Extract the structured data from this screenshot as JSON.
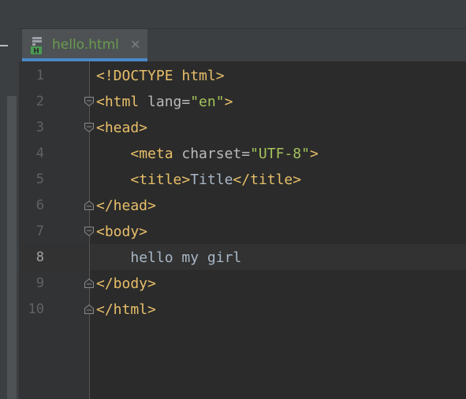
{
  "tab": {
    "filename": "hello.html",
    "close_glyph": "✕",
    "icon": "html-file-icon",
    "icon_letter": "H"
  },
  "line_numbers": [
    "1",
    "2",
    "3",
    "4",
    "5",
    "6",
    "7",
    "8",
    "9",
    "10"
  ],
  "code": {
    "line1": {
      "doctype": "<!DOCTYPE",
      "rest": " html>"
    },
    "line2": {
      "open": "<html",
      "attr": " lang",
      "eq": "=",
      "value": "\"en\"",
      "close": ">"
    },
    "line3": {
      "tag": "<head>"
    },
    "line4": {
      "indent": "    ",
      "open": "<meta",
      "attr": " charset",
      "eq": "=",
      "value": "\"UTF-8\"",
      "close": ">"
    },
    "line5": {
      "indent": "    ",
      "open_tag": "<title>",
      "text": "Title",
      "close_tag": "</title>"
    },
    "line6": {
      "tag": "</head>"
    },
    "line7": {
      "tag": "<body>"
    },
    "line8": {
      "indent": "    ",
      "text": "hello my girl"
    },
    "line9": {
      "tag": "</body>"
    },
    "line10": {
      "tag": "</html>"
    }
  },
  "colors": {
    "background": "#2b2b2b",
    "gutter": "#313335",
    "tag": "#e8bf6a",
    "attribute_value": "#a5c25c",
    "text": "#a9b7c6",
    "tab_label": "#6a9b4f",
    "tab_underline": "#4a88c7"
  }
}
